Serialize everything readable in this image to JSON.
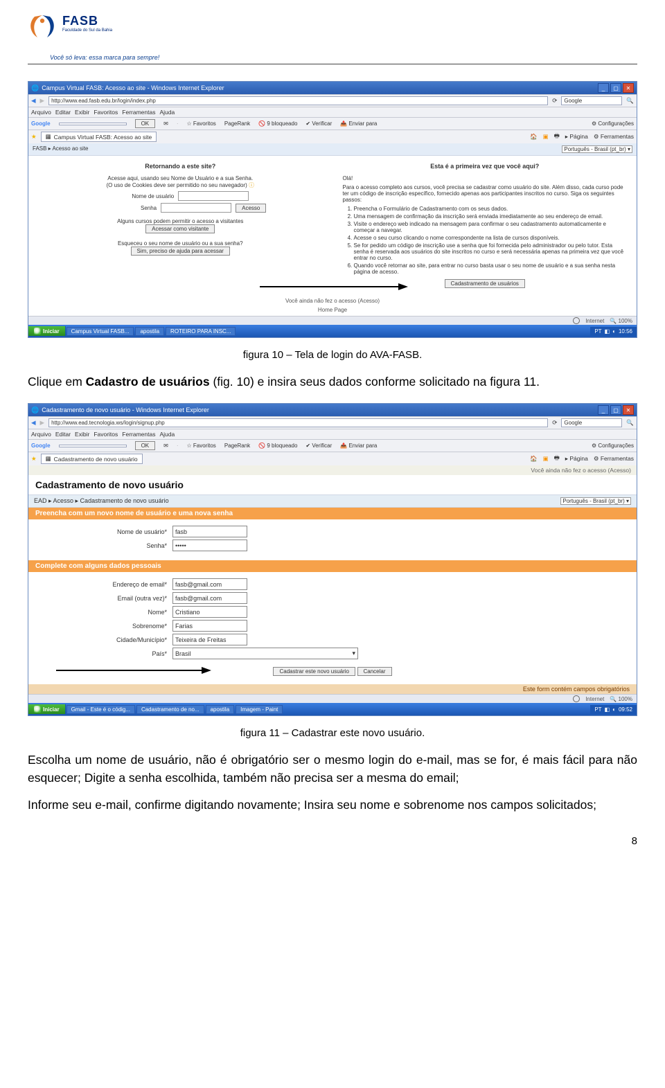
{
  "header": {
    "logo_label": "FASB",
    "logo_sub": "Faculdade do Sul da Bahia",
    "tagline": "Você só leva: essa marca para sempre!"
  },
  "caption_fig10": "figura 10 – Tela de login do AVA-FASB.",
  "para1_a": "Clique em ",
  "para1_b": "Cadastro de usuários",
  "para1_c": " (fig. 10) e insira seus dados conforme solicitado na figura 11.",
  "caption_fig11": "figura 11 – Cadastrar este novo usuário.",
  "para2": "Escolha um nome de usuário, não é obrigatório ser o mesmo login do e-mail, mas se for, é mais fácil para não esquecer; Digite a senha escolhida, também não precisa ser a mesma do email;",
  "para3": "Informe seu e-mail, confirme digitando novamente; Insira seu nome e sobrenome nos campos solicitados;",
  "page_number": "8",
  "shot1": {
    "window_title": "Campus Virtual FASB: Acesso ao site - Windows Internet Explorer",
    "url": "http://www.ead.fasb.edu.br/login/index.php",
    "search_placeholder": "Google",
    "menu": [
      "Arquivo",
      "Editar",
      "Exibir",
      "Favoritos",
      "Ferramentas",
      "Ajuda"
    ],
    "google_label": "Google",
    "ok_btn": "OK",
    "toolbar_items": [
      "Favoritos",
      "PageRank",
      "9 bloqueado",
      "Verificar",
      "Enviar para",
      "Configurações"
    ],
    "tab_label": "Campus Virtual FASB: Acesso ao site",
    "page_tools": [
      "Página",
      "Ferramentas"
    ],
    "breadcrumb": "FASB ▸ Acesso ao site",
    "lang": "Português - Brasil (pt_br)",
    "left": {
      "title": "Retornando a este site?",
      "intro1": "Acesse aqui, usando seu Nome de Usuário e a sua Senha.",
      "intro2": "(O uso de Cookies deve ser permitido no seu navegador)",
      "user_label": "Nome de usuário",
      "pass_label": "Senha",
      "access_btn": "Acesso",
      "guest_line": "Alguns cursos podem permitir o acesso a visitantes",
      "guest_btn": "Acessar como visitante",
      "forgot_q": "Esqueceu o seu nome de usuário ou a sua senha?",
      "forgot_btn": "Sim, preciso de ajuda para acessar"
    },
    "right": {
      "title": "Esta é a primeira vez que você aqui?",
      "hello": "Olá!",
      "intro": "Para o acesso completo aos cursos, você precisa se cadastrar como usuário do site. Além disso, cada curso pode ter um código de inscrição específico, fornecido apenas aos participantes inscritos no curso. Siga os seguintes passos:",
      "steps": [
        "Preencha o Formulário de Cadastramento com os seus dados.",
        "Uma mensagem de confirmação da inscrição será enviada imediatamente ao seu endereço de email.",
        "Visite o endereço web indicado na mensagem para confirmar o seu cadastramento automaticamente e começar a navegar.",
        "Acesse o seu curso clicando o nome correspondente na lista de cursos disponíveis.",
        "Se for pedido um código de inscrição use a senha que foi fornecida pelo administrador ou pelo tutor. Esta senha é reservada aos usuários do site inscritos no curso e será necessária apenas na primeira vez que você entrar no curso.",
        "Quando você retornar ao site, para entrar no curso basta usar o seu nome de usuário e a sua senha nesta página de acesso."
      ],
      "register_btn": "Cadastramento de usuários"
    },
    "footer": {
      "not_logged": "Você ainda não fez o acesso (Acesso)",
      "home": "Home Page"
    },
    "status": {
      "internet": "Internet",
      "zoom": "100%"
    },
    "taskbar": {
      "start": "Iniciar",
      "items": [
        "Campus Virtual FASB...",
        "apostila",
        "ROTEIRO PARA INSC..."
      ],
      "tray": "PT",
      "time": "10:56"
    }
  },
  "shot2": {
    "window_title": "Cadastramento de novo usuário - Windows Internet Explorer",
    "url": "http://www.ead.tecnologia.ws/login/signup.php",
    "search_placeholder": "Google",
    "menu": [
      "Arquivo",
      "Editar",
      "Exibir",
      "Favoritos",
      "Ferramentas",
      "Ajuda"
    ],
    "google_label": "Google",
    "ok_btn": "OK",
    "toolbar_items": [
      "Favoritos",
      "PageRank",
      "9 bloqueado",
      "Verificar",
      "Enviar para",
      "Configurações"
    ],
    "tab_label": "Cadastramento de novo usuário",
    "page_tools": [
      "Página",
      "Ferramentas"
    ],
    "page_heading": "Cadastramento de novo usuário",
    "login_status": "Você ainda não fez o acesso (Acesso)",
    "breadcrumb": "EAD ▸ Acesso ▸ Cadastramento de novo usuário",
    "lang": "Português - Brasil (pt_br)",
    "sec1_title": "Preencha com um novo nome de usuário e uma nova senha",
    "fields1": {
      "user_label": "Nome de usuário*",
      "user_value": "fasb",
      "pass_label": "Senha*",
      "pass_value": "•••••"
    },
    "sec2_title": "Complete com alguns dados pessoais",
    "fields2": {
      "email_label": "Endereço de email*",
      "email_value": "fasb@gmail.com",
      "email2_label": "Email (outra vez)*",
      "email2_value": "fasb@gmail.com",
      "name_label": "Nome*",
      "name_value": "Cristiano",
      "surname_label": "Sobrenome*",
      "surname_value": "Farias",
      "city_label": "Cidade/Município*",
      "city_value": "Teixeira de Freitas",
      "country_label": "País*",
      "country_value": "Brasil"
    },
    "submit_btn": "Cadastrar este novo usuário",
    "cancel_btn": "Cancelar",
    "required_note": "Este form contém campos obrigatórios",
    "status": {
      "internet": "Internet",
      "zoom": "100%"
    },
    "taskbar": {
      "start": "Iniciar",
      "items": [
        "Gmail - Este é o códig...",
        "Cadastramento de no...",
        "apostila",
        "Imagem - Paint"
      ],
      "tray": "PT",
      "time": "09:52"
    }
  }
}
